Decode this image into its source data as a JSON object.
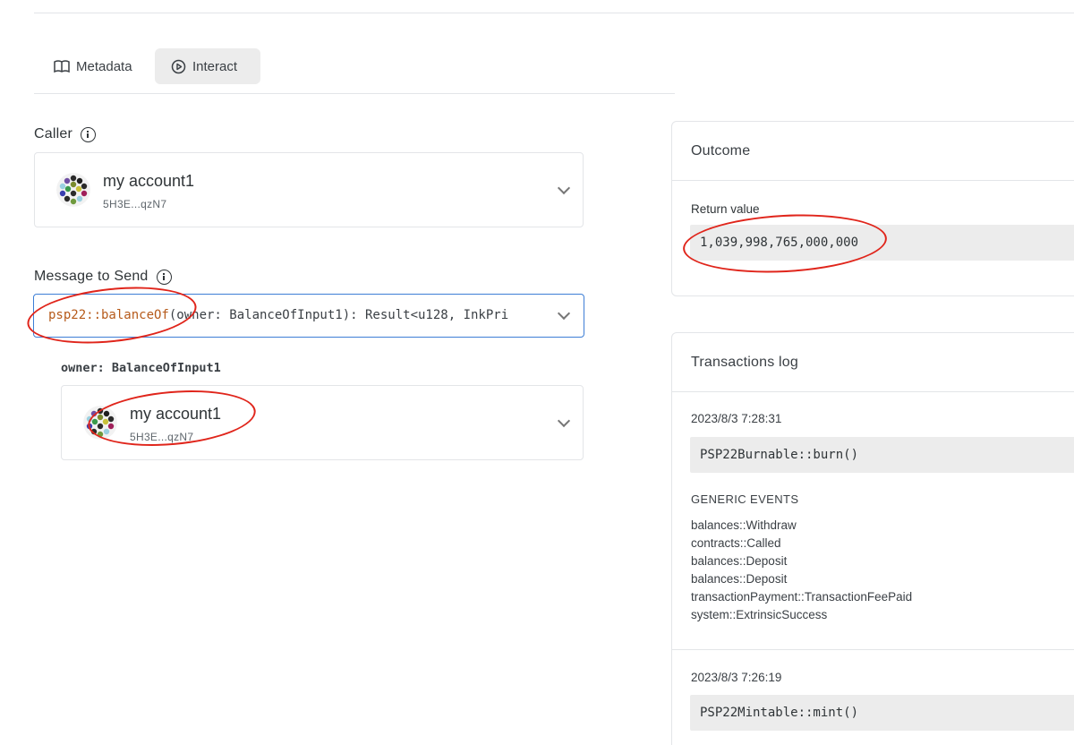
{
  "tabs": [
    {
      "label": "Metadata",
      "icon": "book-icon",
      "active": false
    },
    {
      "label": "Interact",
      "icon": "play-circle-icon",
      "active": true
    }
  ],
  "caller": {
    "label": "Caller",
    "account_name": "my account1",
    "account_address": "5H3E...qzN7"
  },
  "message": {
    "label": "Message to Send",
    "fn_name": "psp22::balanceOf",
    "signature_rest": "(owner: BalanceOfInput1): Result<u128, InkPri",
    "arg_label": "owner: BalanceOfInput1",
    "arg_account_name": "my account1",
    "arg_account_address": "5H3E...qzN7"
  },
  "outcome": {
    "title": "Outcome",
    "return_label": "Return value",
    "return_value": "1,039,998,765,000,000"
  },
  "transactions_log": {
    "title": "Transactions log",
    "entries": [
      {
        "timestamp": "2023/8/3 7:28:31",
        "call": "PSP22Burnable::burn()",
        "events_title": "GENERIC EVENTS",
        "events": [
          "balances::Withdraw",
          "contracts::Called",
          "balances::Deposit",
          "balances::Deposit",
          "transactionPayment::TransactionFeePaid",
          "system::ExtrinsicSuccess"
        ]
      },
      {
        "timestamp": "2023/8/3 7:26:19",
        "call": "PSP22Mintable::mint()"
      }
    ]
  },
  "colors": {
    "accent_border": "#3d7ed6",
    "function_name": "#b65a1a",
    "annotation_red": "#e0251b",
    "code_bg": "#ececec"
  }
}
